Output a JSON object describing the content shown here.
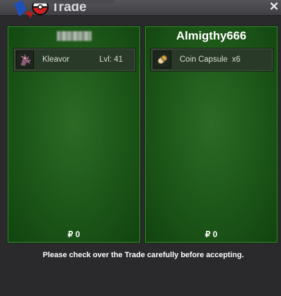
{
  "window": {
    "title": "Trade",
    "close_symbol": "✕"
  },
  "left_panel": {
    "player_name_redacted": true,
    "slots": [
      {
        "name": "Kleavor",
        "level": "Lvl: 41",
        "icon": "kleavor-icon"
      }
    ],
    "money": "₽ 0"
  },
  "right_panel": {
    "player_name": "Almigthy666",
    "slots": [
      {
        "name": "Coin Capsule  x6",
        "icon": "coin-capsule-icon"
      }
    ],
    "money": "₽ 0"
  },
  "footer": {
    "notice": "Please check over the Trade carefully before accepting."
  },
  "colors": {
    "panel_green": "#1f5a1a",
    "background": "#2a2a2d",
    "titlebar": "#4a4a50"
  }
}
